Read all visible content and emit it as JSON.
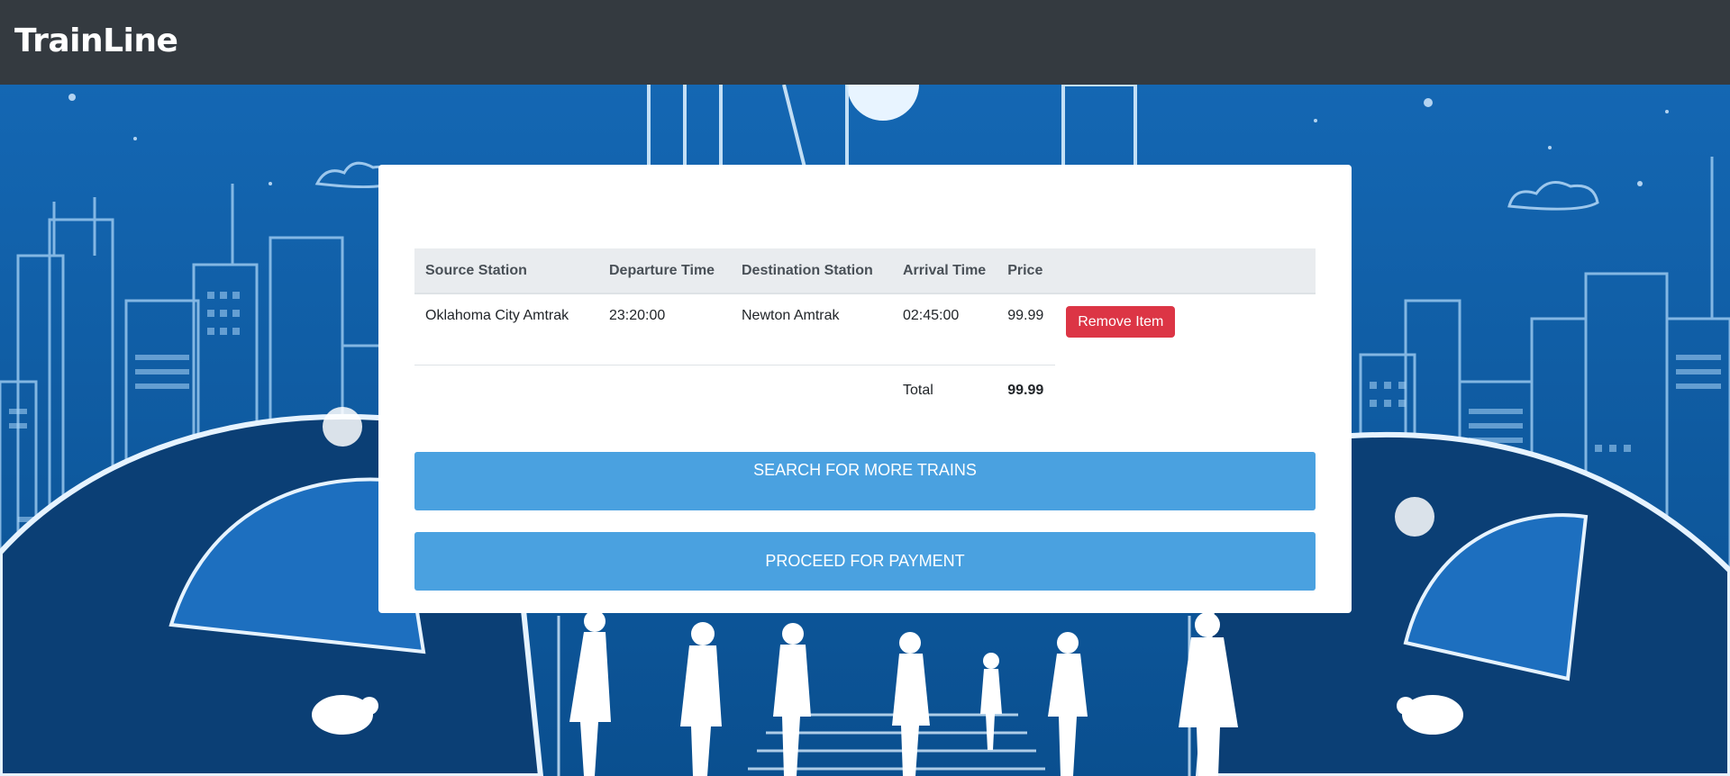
{
  "navbar": {
    "brand": "TrainLine"
  },
  "cart": {
    "columns": [
      "Source Station",
      "Departure Time",
      "Destination Station",
      "Arrival Time",
      "Price"
    ],
    "items": [
      {
        "source_station": "Oklahoma City Amtrak",
        "departure_time": "23:20:00",
        "destination_station": "Newton Amtrak",
        "arrival_time": "02:45:00",
        "price": "99.99",
        "remove_label": "Remove Item"
      }
    ],
    "total_label": "Total",
    "total_value": "99.99"
  },
  "actions": {
    "search_more": "SEARCH FOR MORE TRAINS",
    "proceed_payment": "PROCEED FOR PAYMENT"
  },
  "colors": {
    "navbar": "#343a40",
    "hero_background": "#0f5fa8",
    "remove_button": "#dc3545",
    "action_button": "#4aa1e0"
  }
}
